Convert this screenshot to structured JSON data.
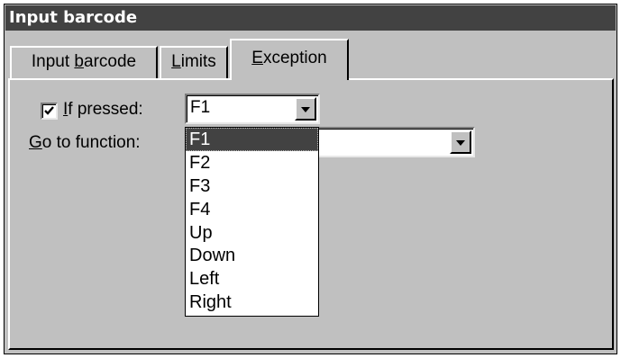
{
  "window": {
    "title": "Input barcode"
  },
  "tabs": [
    {
      "label_pre": "Input ",
      "mnemonic": "b",
      "label_post": "arcode"
    },
    {
      "label_pre": "",
      "mnemonic": "L",
      "label_post": "imits"
    },
    {
      "label_pre": "",
      "mnemonic": "E",
      "label_post": "xception"
    }
  ],
  "active_tab": "Exception",
  "if_pressed": {
    "checked": true,
    "label_mnemonic": "I",
    "label_rest": "f pressed:",
    "value": "F1"
  },
  "go_to_function": {
    "label_mnemonic": "G",
    "label_rest": "o to function:",
    "value": ""
  },
  "dropdown_options": [
    "F1",
    "F2",
    "F3",
    "F4",
    "Up",
    "Down",
    "Left",
    "Right"
  ],
  "dropdown_selected": "F1",
  "icons": [
    "checkmark-icon",
    "dropdown-arrow-icon"
  ]
}
